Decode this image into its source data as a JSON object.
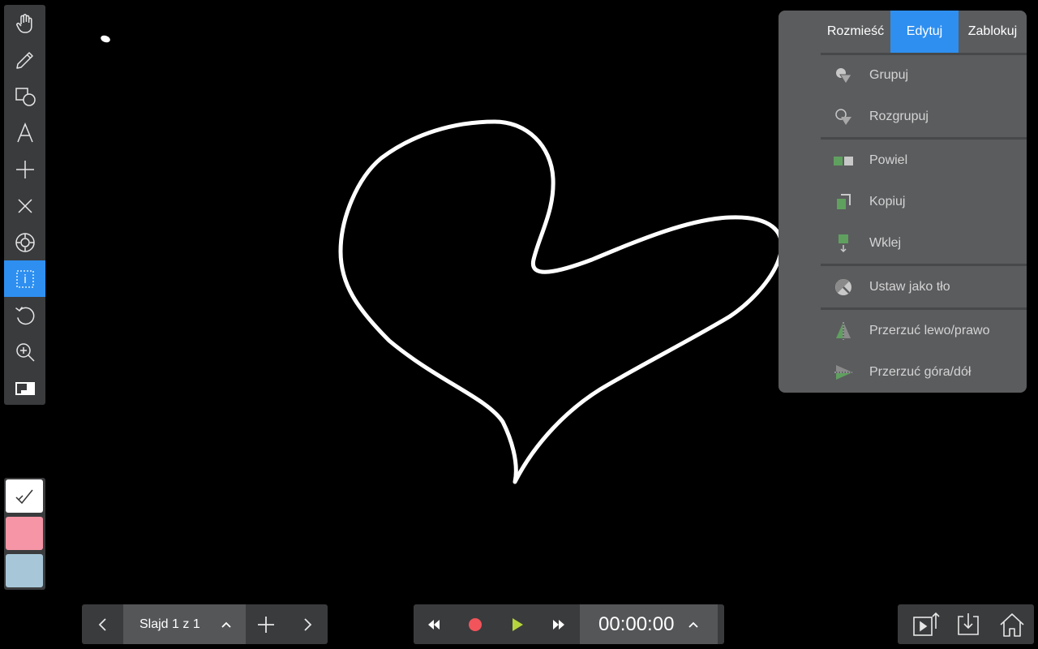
{
  "toolbar": {
    "tools": [
      {
        "name": "hand-icon"
      },
      {
        "name": "pencil-icon"
      },
      {
        "name": "shapes-icon"
      },
      {
        "name": "text-icon"
      },
      {
        "name": "plus-icon"
      },
      {
        "name": "close-icon"
      },
      {
        "name": "target-icon"
      },
      {
        "name": "selection-icon"
      },
      {
        "name": "undo-icon"
      },
      {
        "name": "zoom-in-icon"
      },
      {
        "name": "background-icon"
      }
    ],
    "active_tool": "selection-icon"
  },
  "colors": {
    "accent": "#2e8ff0",
    "panel": "#3a3b3d",
    "swatches": [
      "#ffffff",
      "#f595a5",
      "#a7c7d9"
    ]
  },
  "menu": {
    "tabs": [
      {
        "label": "Rozmieść",
        "active": false
      },
      {
        "label": "Edytuj",
        "active": true
      },
      {
        "label": "Zablokuj",
        "active": false
      }
    ],
    "items": [
      {
        "label": "Grupuj",
        "icon": "group-icon"
      },
      {
        "label": "Rozgrupuj",
        "icon": "ungroup-icon"
      },
      {
        "label": "Powiel",
        "icon": "duplicate-icon"
      },
      {
        "label": "Kopiuj",
        "icon": "copy-icon"
      },
      {
        "label": "Wklej",
        "icon": "paste-icon"
      },
      {
        "label": "Ustaw jako tło",
        "icon": "set-background-icon"
      },
      {
        "label": "Przerzuć lewo/prawo",
        "icon": "flip-horizontal-icon"
      },
      {
        "label": "Przerzuć góra/dół",
        "icon": "flip-vertical-icon"
      }
    ]
  },
  "slides": {
    "label": "Slajd 1 z 1"
  },
  "playback": {
    "time": "00:00:00"
  }
}
